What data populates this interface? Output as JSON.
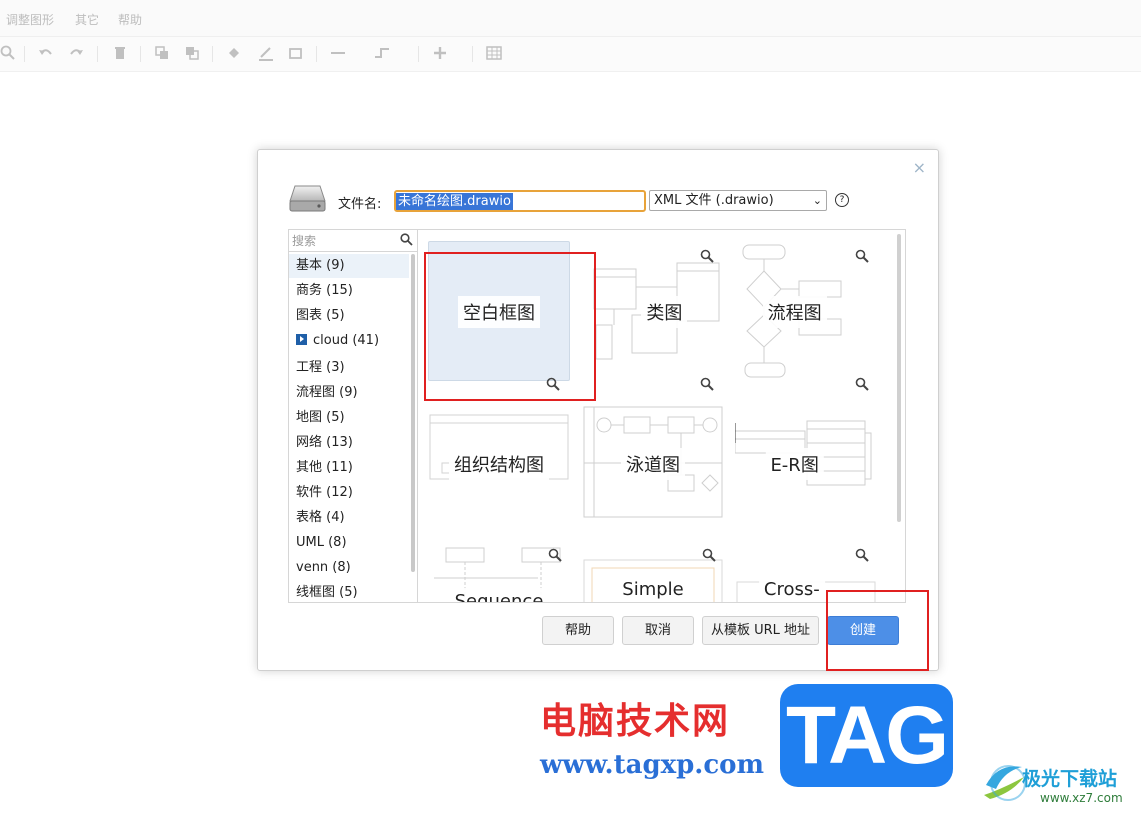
{
  "menu": {
    "items": [
      "调整图形",
      "其它",
      "帮助"
    ]
  },
  "toolbar": {
    "icons": [
      "zoom-icon",
      "undo-icon",
      "redo-icon",
      "delete-icon",
      "to-front-icon",
      "to-back-icon",
      "fill-color-icon",
      "line-color-icon",
      "shadow-icon",
      "connection-icon",
      "waypoints-icon",
      "insert-icon",
      "table-icon"
    ]
  },
  "dialog": {
    "close": "×",
    "filename_label": "文件名:",
    "filename_value": "未命名绘图.drawio",
    "format": "XML 文件 (.drawio)",
    "format_chevron": "⌄",
    "help_symbol": "?",
    "search_placeholder": "搜索",
    "categories": [
      {
        "label": "基本 (9)",
        "active": true
      },
      {
        "label": "商务 (15)"
      },
      {
        "label": "图表 (5)"
      },
      {
        "label": "cloud (41)",
        "icon": "cloud-expand-icon"
      },
      {
        "label": "工程 (3)"
      },
      {
        "label": "流程图 (9)"
      },
      {
        "label": "地图 (5)"
      },
      {
        "label": "网络 (13)"
      },
      {
        "label": "其他 (11)"
      },
      {
        "label": "软件 (12)"
      },
      {
        "label": "表格 (4)"
      },
      {
        "label": "UML (8)"
      },
      {
        "label": "venn (8)"
      },
      {
        "label": "线框图 (5)"
      }
    ],
    "templates": [
      {
        "label": "空白框图",
        "selected": true
      },
      {
        "label": "类图"
      },
      {
        "label": "流程图"
      },
      {
        "label": "组织结构图"
      },
      {
        "label": "泳道图"
      },
      {
        "label": "E-R图"
      },
      {
        "label": "Sequence"
      },
      {
        "label": "Simple"
      },
      {
        "label": "Cross-"
      }
    ],
    "buttons": {
      "help": "帮助",
      "cancel": "取消",
      "from_url": "从模板 URL 地址",
      "create": "创建"
    }
  },
  "watermark": {
    "site_cn": "电脑技术网",
    "site_url": "www.tagxp.com",
    "tag": "TAG",
    "brand": "极光下载站",
    "brand_url": "www.xz7.com"
  },
  "colors": {
    "highlight_red": "#e02020",
    "primary_button": "#4d8fe7",
    "selection": "#3875d7",
    "blank_template": "#e4ecf6"
  }
}
